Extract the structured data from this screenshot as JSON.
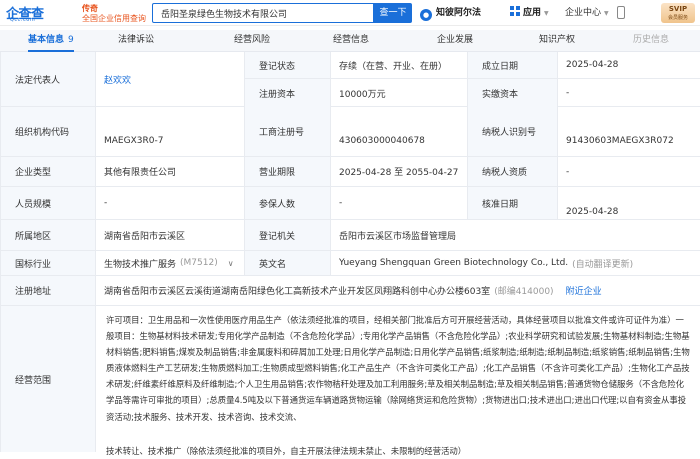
{
  "header": {
    "logo_text": "企查查",
    "logo_domain": "Qcc.com",
    "slogan_line1": "传奇",
    "slogan_line2": "全国企业信用查询",
    "search_value": "岳阳圣泉绿色生物技术有限公司",
    "search_button": "查一下",
    "ai_label": "知彼阿尔法",
    "app_label": "应用",
    "center_label": "企业中心",
    "vip_top": "SVIP",
    "vip_bottom": "会员服务"
  },
  "tabs": [
    {
      "label": "基本信息",
      "count": "9"
    },
    {
      "label": "法律诉讼"
    },
    {
      "label": "经营风险"
    },
    {
      "label": "经营信息"
    },
    {
      "label": "企业发展"
    },
    {
      "label": "知识产权"
    },
    {
      "label": "历史信息"
    }
  ],
  "info": {
    "legal_rep_label": "法定代表人",
    "legal_rep_value": "赵欢欢",
    "reg_status_label": "登记状态",
    "reg_status_value": "存续（在营、开业、在册）",
    "est_date_label": "成立日期",
    "est_date_value": "2025-04-28",
    "reg_capital_label": "注册资本",
    "reg_capital_value": "10000万元",
    "paid_capital_label": "实缴资本",
    "paid_capital_value": "-",
    "org_code_label": "组织机构代码",
    "org_code_value": "MAEGX3R0-7",
    "biz_reg_label": "工商注册号",
    "biz_reg_value": "430603000040678",
    "taxpayer_id_label": "纳税人识别号",
    "taxpayer_id_value": "91430603MAEGX3R072",
    "company_type_label": "企业类型",
    "company_type_value": "其他有限责任公司",
    "biz_term_label": "营业期限",
    "biz_term_value": "2025-04-28 至 2055-04-27",
    "taxpayer_qual_label": "纳税人资质",
    "taxpayer_qual_value": "-",
    "staff_size_label": "人员规模",
    "staff_size_value": "-",
    "insured_label": "参保人数",
    "insured_value": "-",
    "approve_date_label": "核准日期",
    "approve_date_value": "2025-04-28",
    "region_label": "所属地区",
    "region_value": "湖南省岳阳市云溪区",
    "authority_label": "登记机关",
    "authority_value": "岳阳市云溪区市场监督管理局",
    "industry_label": "国标行业",
    "industry_value": "生物技术推广服务",
    "industry_code": "(M7512)",
    "english_label": "英文名",
    "english_value": "Yueyang Shengquan Green Biotechnology Co., Ltd.",
    "english_note": "(自动翻译更新)",
    "address_label": "注册地址",
    "address_value": "湖南省岳阳市云溪区云溪街道湖南岳阳绿色化工高新技术产业开发区凤翔路科创中心办公楼603室",
    "postcode": "(邮编414000)",
    "nearby_link": "附近企业",
    "scope_label": "经营范围",
    "scope_text_1": "许可项目：卫生用品和一次性使用医疗用品生产（依法须经批准的项目，经相关部门批准后方可开展经营活动，具体经营项目以批准文件或许可证件为准）一般项目：生物基材料技术研发;专用化学产品制造（不含危险化学品）;专用化学产品销售（不含危险化学品）;农业科学研究和试验发展;生物基材料制造;生物基材料销售;肥料销售;煤炭及制品销售;非金属废料和碎屑加工处理;日用化学产品制造;日用化学产品销售;纸浆制造;纸制造;纸制品制造;纸浆销售;纸制品销售;生物质液体燃料生产工艺研发;生物质燃料加工;生物质成型燃料销售;化工产品生产（不含许可类化工产品）;化工产品销售（不含许可类化工产品）;生物化工产品技术研发;纤维素纤维原料及纤维制造;个人卫生用品销售;农作物秸秆处理及加工利用服务;草及相关制品制造;草及相关制品销售;普通货物仓储服务（不含危险化学品等需许可审批的项目）;总质量4.5吨及以下普通货运车辆道路货物运输（除网络货运和危险货物）;货物进出口;技术进出口;进出口代理;以自有资金从事投资活动;技术服务、技术开发、技术咨询、技术交流、",
    "scope_text_2": "技术转让、技术推广（除依法须经批准的项目外，自主开展法律法规未禁止、未限制的经营活动）"
  }
}
